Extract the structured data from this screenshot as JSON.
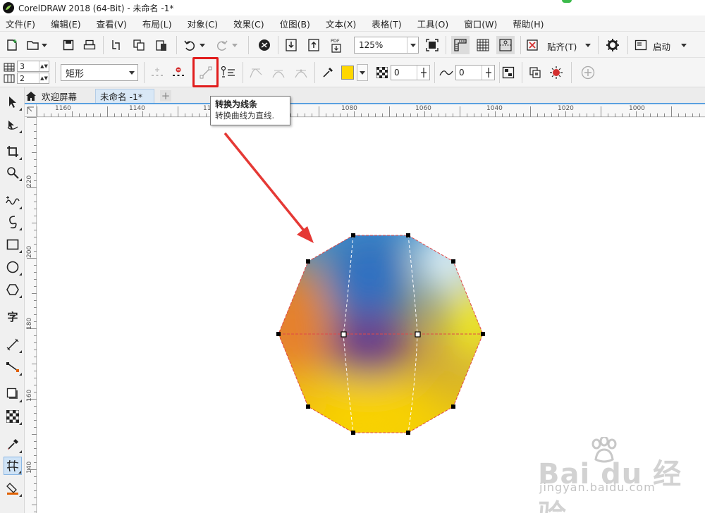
{
  "window": {
    "title": "CorelDRAW 2018 (64-Bit) - 未命名 -1*"
  },
  "menu": {
    "items": [
      "文件(F)",
      "编辑(E)",
      "查看(V)",
      "布局(L)",
      "对象(C)",
      "效果(C)",
      "位图(B)",
      "文本(X)",
      "表格(T)",
      "工具(O)",
      "窗口(W)",
      "帮助(H)"
    ]
  },
  "standard_toolbar": {
    "zoom_level": "125%",
    "snap_label": "贴齐(T)",
    "start_label": "启动"
  },
  "property_bar": {
    "rows_value": "3",
    "cols_value": "2",
    "shape_type": "矩形",
    "outline_value": "0",
    "smooth_value": "0",
    "fill_color": "#ffd700"
  },
  "tooltip": {
    "title": "转换为线条",
    "description": "转换曲线为直线."
  },
  "document_tabs": {
    "welcome": "欢迎屏幕",
    "current": "未命名 -1*",
    "add": "+"
  },
  "rulers": {
    "top_labels": [
      "1160",
      "1140",
      "11",
      "1080",
      "1060",
      "1040",
      "1020",
      "1000"
    ],
    "left_labels": [
      "220",
      "200",
      "180",
      "160",
      "140"
    ],
    "corner_label": "!\""
  },
  "watermark": {
    "brand": "Bai  du 经验",
    "url": "jingyan.baidu.com"
  },
  "colors": {
    "highlight": "#e11d1d",
    "arrow": "#e53935",
    "accent_blue": "#5aa0e0"
  }
}
